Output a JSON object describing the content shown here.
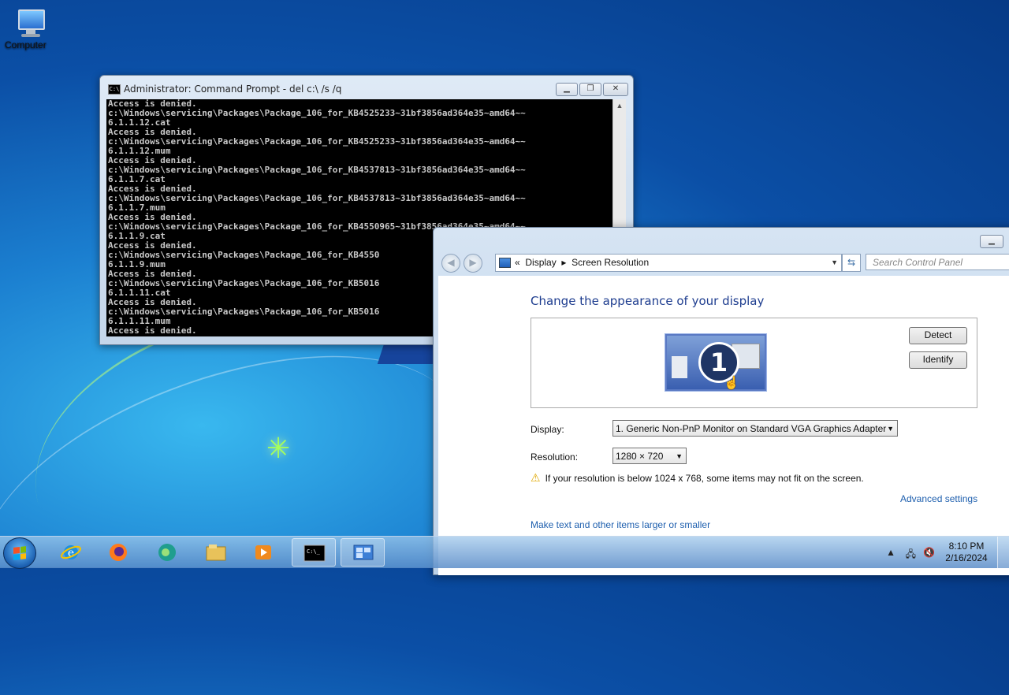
{
  "desktop": {
    "icons": [
      {
        "label": "Computer"
      }
    ]
  },
  "cmd_window": {
    "title": "Administrator:  Command Prompt - del  c:\\ /s /q",
    "console_lines": [
      "Access is denied.",
      "c:\\Windows\\servicing\\Packages\\Package_106_for_KB4525233~31bf3856ad364e35~amd64~~",
      "6.1.1.12.cat",
      "Access is denied.",
      "c:\\Windows\\servicing\\Packages\\Package_106_for_KB4525233~31bf3856ad364e35~amd64~~",
      "6.1.1.12.mum",
      "Access is denied.",
      "c:\\Windows\\servicing\\Packages\\Package_106_for_KB4537813~31bf3856ad364e35~amd64~~",
      "6.1.1.7.cat",
      "Access is denied.",
      "c:\\Windows\\servicing\\Packages\\Package_106_for_KB4537813~31bf3856ad364e35~amd64~~",
      "6.1.1.7.mum",
      "Access is denied.",
      "c:\\Windows\\servicing\\Packages\\Package_106_for_KB4550965~31bf3856ad364e35~amd64~~",
      "6.1.1.9.cat",
      "Access is denied.",
      "c:\\Windows\\servicing\\Packages\\Package_106_for_KB4550",
      "6.1.1.9.mum",
      "Access is denied.",
      "c:\\Windows\\servicing\\Packages\\Package_106_for_KB5016",
      "6.1.1.11.cat",
      "Access is denied.",
      "c:\\Windows\\servicing\\Packages\\Package_106_for_KB5016",
      "6.1.1.11.mum",
      "Access is denied."
    ]
  },
  "control_panel": {
    "breadcrumb": {
      "prefix": "«",
      "root": "Display",
      "sep": "▸",
      "current": "Screen Resolution"
    },
    "search_placeholder": "Search Control Panel",
    "heading": "Change the appearance of your display",
    "monitor_number": "1",
    "detect_label": "Detect",
    "identify_label": "Identify",
    "display_label": "Display:",
    "display_value": "1. Generic Non-PnP Monitor on Standard VGA Graphics Adapter",
    "resolution_label": "Resolution:",
    "resolution_value": "1280 × 720",
    "warning_text": "If your resolution is below 1024 x 768, some items may not fit on the screen.",
    "advanced_link": "Advanced settings",
    "text_size_link": "Make text and other items larger or smaller"
  },
  "taskbar": {
    "apps": [
      {
        "icon": "internet-explorer-icon"
      },
      {
        "icon": "firefox-icon"
      },
      {
        "icon": "edge-icon"
      },
      {
        "icon": "file-explorer-icon"
      },
      {
        "icon": "media-player-icon"
      },
      {
        "icon": "command-prompt-icon",
        "active": true
      },
      {
        "icon": "control-panel-icon",
        "active": true
      }
    ],
    "time": "8:10 PM",
    "date": "2/16/2024"
  }
}
